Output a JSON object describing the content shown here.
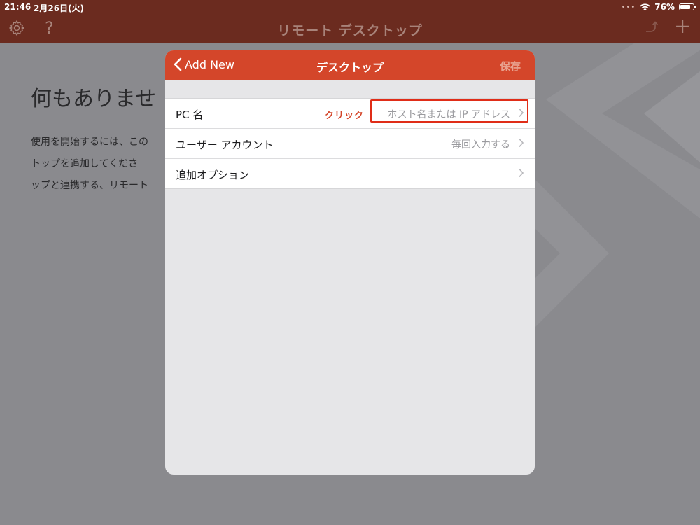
{
  "status_bar": {
    "time": "21:46",
    "date": "2月26日(火)",
    "battery": "76%"
  },
  "nav": {
    "title": "リモート デスクトップ"
  },
  "background": {
    "heading": "何もありませ",
    "lines": [
      "使用を開始するには、この",
      "トップを追加してくださ",
      "ップと連携する、リモート"
    ]
  },
  "modal": {
    "back_label": "Add New",
    "title": "デスクトップ",
    "save_label": "保存",
    "rows": [
      {
        "label": "PC 名",
        "value": "ホスト名または IP アドレス"
      },
      {
        "label": "ユーザー アカウント",
        "value": "毎回入力する"
      },
      {
        "label": "追加オプション",
        "value": ""
      }
    ],
    "annotation": "クリック"
  },
  "colors": {
    "bar": "#6b2b1f",
    "accent": "#d4462a",
    "highlight": "#e02d18"
  }
}
